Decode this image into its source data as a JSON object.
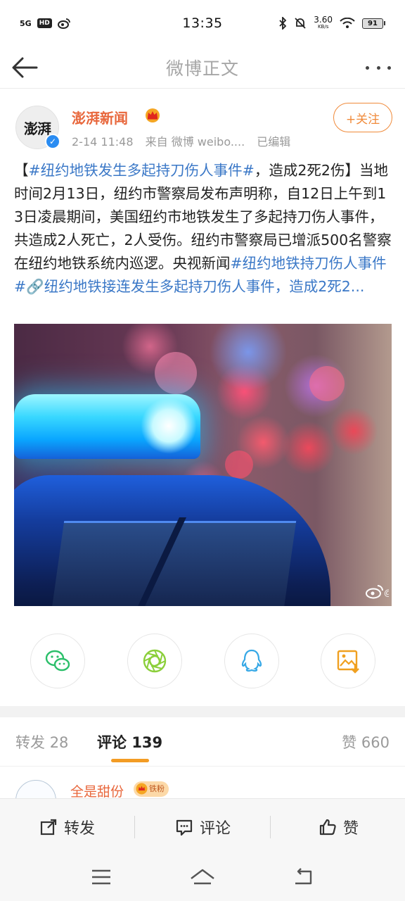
{
  "status_bar": {
    "network": "5G",
    "hd": "HD",
    "time": "13:35",
    "speed_value": "3.60",
    "speed_unit": "KB/s",
    "battery": "91"
  },
  "nav": {
    "title": "微博正文"
  },
  "post": {
    "author": "澎湃新闻",
    "avatar_text": "澎湃",
    "date": "2-14 11:48",
    "source": "来自 微博 weibo....",
    "edited": "已编辑",
    "follow_label": "+关注",
    "text_segments": [
      {
        "text": "【",
        "tag": false
      },
      {
        "text": "#纽约地铁发生多起持刀伤人事件#",
        "tag": true
      },
      {
        "text": "，造成2死2伤】当地时间2月13日，纽约市警察局发布声明称，自12日上午到13日凌晨期间，美国纽约市地铁发生了多起持刀伤人事件，共造成2人死亡，2人受伤。纽约市警察局已增派500名警察在纽约地铁系统内巡逻。央视新闻",
        "tag": false
      },
      {
        "text": "#纽约地铁持刀伤人事件#",
        "tag": true
      },
      {
        "text": "🔗纽约地铁接连发生多起持刀伤人事件，造成2死2...",
        "tag": true
      }
    ],
    "image_watermark": "@"
  },
  "share": {
    "buttons": [
      "wechat-icon",
      "moments-icon",
      "qq-icon",
      "save-image-icon"
    ]
  },
  "tabs": {
    "repost_label": "转发",
    "repost_count": "28",
    "comment_label": "评论",
    "comment_count": "139",
    "like_label": "赞",
    "like_count": "660"
  },
  "comment_preview": {
    "user": "全是甜份",
    "badge": "铁粉"
  },
  "action_bar": {
    "repost": "转发",
    "comment": "评论",
    "like": "赞"
  },
  "colors": {
    "accent_orange": "#f08a3a",
    "author_orange": "#e8673c",
    "hashtag_blue": "#3b78c7",
    "tab_underline": "#f39c24"
  }
}
